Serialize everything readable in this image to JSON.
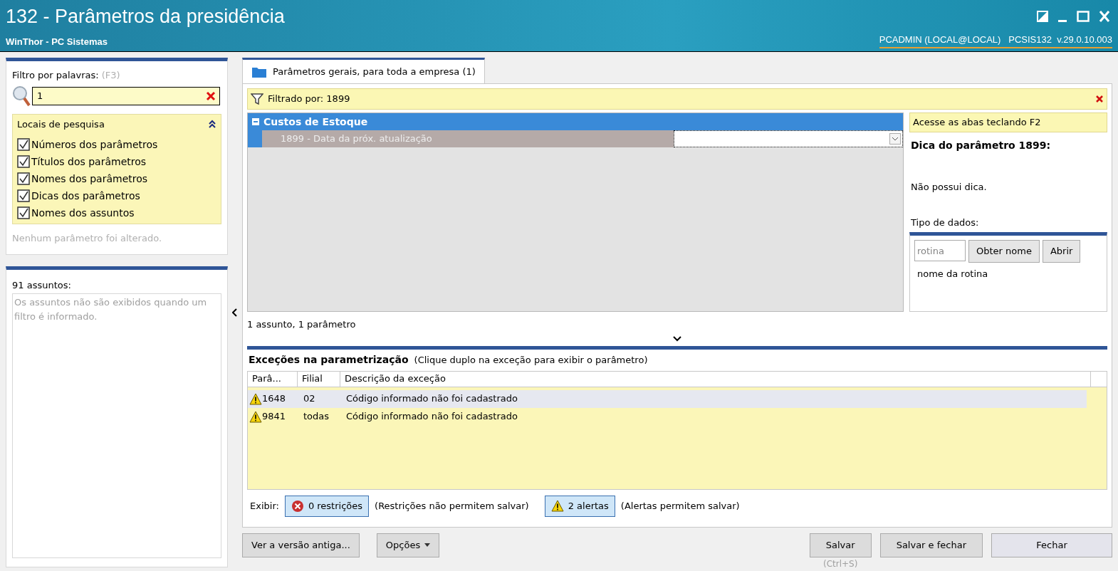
{
  "window": {
    "title": "132 - Parâmetros da presidência",
    "subtitle": "WinThor - PC Sistemas",
    "user_info": "PCADMIN (LOCAL@LOCAL)   PCSIS132  v.29.0.10.003"
  },
  "filter": {
    "label": "Filtro por palavras:",
    "shortcut": "(F3)",
    "value": "1"
  },
  "search_locations": {
    "title": "Locais de pesquisa",
    "expanded": true,
    "options": [
      {
        "label": "Números dos parâmetros",
        "checked": true
      },
      {
        "label": "Títulos dos parâmetros",
        "checked": true
      },
      {
        "label": "Nomes dos parâmetros",
        "checked": true
      },
      {
        "label": "Dicas dos parâmetros",
        "checked": true
      },
      {
        "label": "Nomes dos assuntos",
        "checked": true
      }
    ]
  },
  "changes_note": "Nenhum parâmetro foi alterado.",
  "subjects": {
    "title": "91 assuntos:",
    "note": "Os assuntos não são exibidos quando um filtro é informado."
  },
  "tabs": [
    {
      "label": "Parâmetros gerais, para toda a empresa  (1)",
      "selected": true
    }
  ],
  "filter_bar": {
    "text": "Filtrado por: 1899"
  },
  "parameter_groups": [
    {
      "title": "Custos de Estoque",
      "expanded": true,
      "items": [
        {
          "label": "1899 - Data da próx. atualização",
          "selected": true
        }
      ]
    }
  ],
  "grid_status": "1 assunto, 1 parâmetro",
  "hint_panel": {
    "banner": "Acesse as abas teclando F2",
    "title": "Dica do parâmetro 1899:",
    "hint": "Não possui dica.",
    "data_type_label": "Tipo de dados:",
    "routine_placeholder": "rotina",
    "buttons": [
      "Obter nome",
      "Abrir"
    ],
    "routine_name": "nome da rotina"
  },
  "exceptions": {
    "title": "Exceções na parametrização",
    "subtitle": "(Clique duplo na exceção para exibir o parâmetro)",
    "columns": [
      "Parâ...",
      "Filial",
      "Descrição da exceção"
    ],
    "rows": [
      {
        "cells": [
          "1648",
          "02",
          "Código informado não foi cadastrado"
        ],
        "selected": true
      },
      {
        "cells": [
          "9841",
          "todas",
          "Código informado não foi cadastrado"
        ],
        "selected": false
      }
    ]
  },
  "show_bar": {
    "label": "Exibir:",
    "toggles": [
      {
        "kind": "error",
        "label": "0 restrições",
        "on": true,
        "note": "(Restrições não permitem salvar)"
      },
      {
        "kind": "warning",
        "label": "2 alertas",
        "on": true,
        "note": "(Alertas permitem salvar)"
      }
    ]
  },
  "footer": {
    "left_buttons": [
      {
        "label": "Ver a versão antiga...",
        "dropdown": false
      },
      {
        "label": "Opções",
        "dropdown": true
      }
    ],
    "right_buttons": [
      {
        "label": "Salvar",
        "shortcut": "(Ctrl+S)"
      },
      {
        "label": "Salvar e fechar"
      },
      {
        "label": "Fechar"
      }
    ]
  }
}
